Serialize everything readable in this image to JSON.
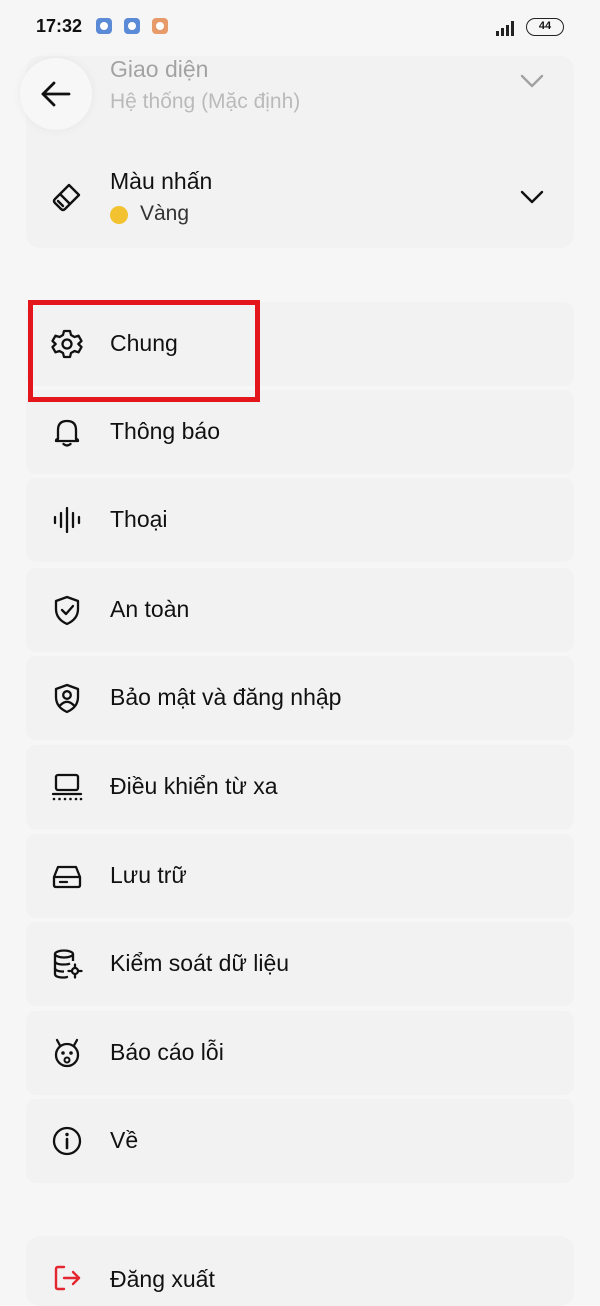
{
  "status_bar": {
    "time": "17:32",
    "battery": "44",
    "notif_colors": [
      "#5b8ad6",
      "#5b8ad6",
      "#e79a6a"
    ]
  },
  "appearance": {
    "theme_title": "Giao diện",
    "theme_value": "Hệ thống (Mặc định)",
    "accent_title": "Màu nhấn",
    "accent_value": "Vàng",
    "accent_color": "#f2c230"
  },
  "menu": {
    "items": [
      {
        "label": "Chung",
        "icon": "gear-icon"
      },
      {
        "label": "Thông báo",
        "icon": "bell-icon"
      },
      {
        "label": "Thoại",
        "icon": "voice-waveform-icon"
      },
      {
        "label": "An toàn",
        "icon": "shield-check-icon"
      },
      {
        "label": "Bảo mật và đăng nhập",
        "icon": "shield-user-icon"
      },
      {
        "label": "Điều khiển từ xa",
        "icon": "remote-device-icon"
      },
      {
        "label": "Lưu trữ",
        "icon": "storage-icon"
      },
      {
        "label": "Kiểm soát dữ liệu",
        "icon": "database-settings-icon"
      },
      {
        "label": "Báo cáo lỗi",
        "icon": "bug-icon"
      },
      {
        "label": "Về",
        "icon": "info-icon"
      }
    ],
    "logout_label": "Đăng xuất",
    "logout_color": "#e3262f",
    "highlight_color": "#e3161b"
  }
}
